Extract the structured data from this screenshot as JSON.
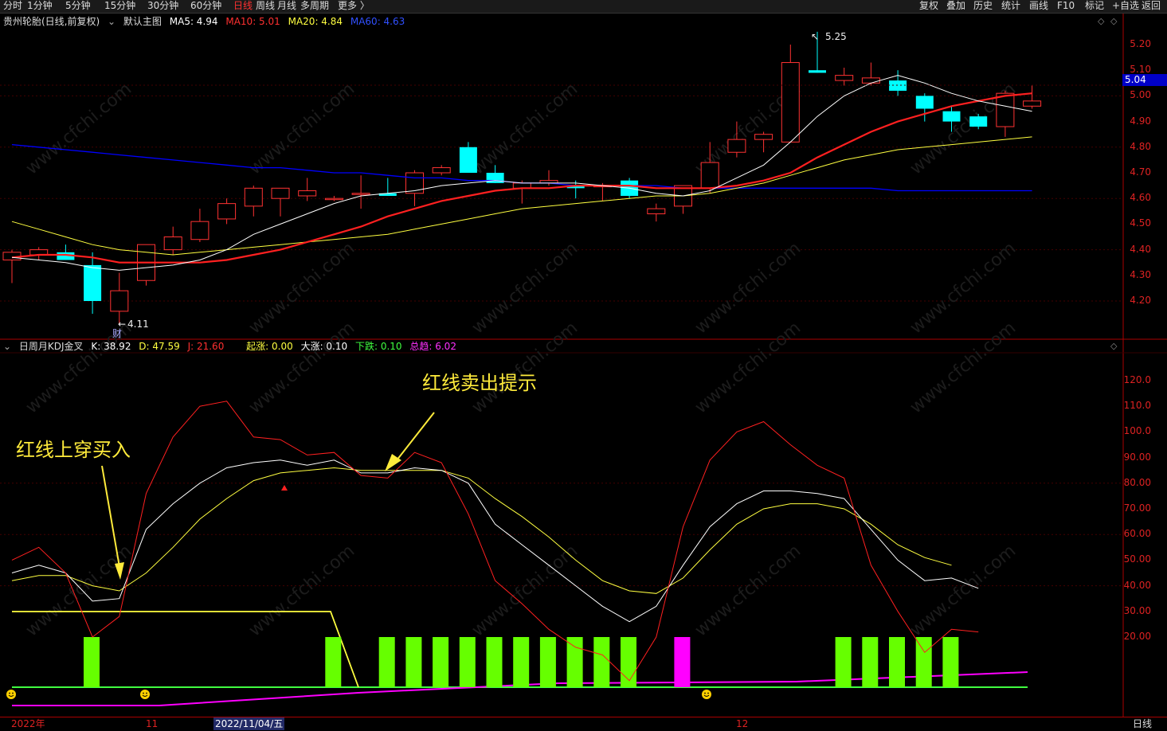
{
  "toolbar": {
    "items": [
      "分时",
      "1分钟",
      "5分钟",
      "15分钟",
      "30分钟",
      "60分钟",
      "日线",
      "周线",
      "月线",
      "多周期",
      "更多 〉"
    ],
    "active": "日线",
    "right_items": [
      "复权",
      "叠加",
      "历史",
      "统计",
      "画线",
      "F10",
      "标记",
      "+自选",
      "返回"
    ]
  },
  "main": {
    "stock": "贵州轮胎(日线,前复权)",
    "template": "默认主图",
    "ma5": "MA5: 4.94",
    "ma10": "MA10: 5.01",
    "ma20": "MA20: 4.84",
    "ma60": "MA60: 4.63",
    "high_label": "5.25",
    "low_label": "4.11",
    "finance_mark": "财",
    "current_price": "5.04",
    "price_ticks": [
      "5.20",
      "5.10",
      "5.00",
      "4.90",
      "4.80",
      "4.70",
      "4.60",
      "4.50",
      "4.40",
      "4.30",
      "4.20"
    ]
  },
  "kdj": {
    "name": "日周月KDJ金叉",
    "k": "K: 38.92",
    "d": "D: 47.59",
    "j": "J: 21.60",
    "qizhang": "起涨: 0.00",
    "dazhang": "大涨: 0.10",
    "xiadie": "下跌: 0.10",
    "zongqu": "总趋: 6.02",
    "ticks": [
      "120.0",
      "110.0",
      "100.0",
      "90.00",
      "80.00",
      "70.00",
      "60.00",
      "50.00",
      "40.00",
      "30.00",
      "20.00"
    ]
  },
  "annotations": {
    "buy": "红线上穿买入",
    "sell": "红线卖出提示"
  },
  "watermark": "www.cfchi.com",
  "bottom": {
    "labels": [
      "2022年",
      "11",
      "12"
    ],
    "selected_date": "2022/11/04/五",
    "period": "日线"
  },
  "colors": {
    "up": "#ff3232",
    "down": "#00ffff",
    "ma5": "#ffffff",
    "ma10": "#ff2020",
    "ma20": "#ffff40",
    "ma60": "#0000ff",
    "green_bar": "#66ff00",
    "magenta_bar": "#ff00ff"
  },
  "chart_data": {
    "type": "candlestick",
    "price_range": [
      4.11,
      5.25
    ],
    "candles": [
      {
        "o": 4.36,
        "h": 4.4,
        "l": 4.27,
        "c": 4.39
      },
      {
        "o": 4.38,
        "h": 4.41,
        "l": 4.36,
        "c": 4.4
      },
      {
        "o": 4.39,
        "h": 4.42,
        "l": 4.36,
        "c": 4.36
      },
      {
        "o": 4.34,
        "h": 4.39,
        "l": 4.15,
        "c": 4.2
      },
      {
        "o": 4.16,
        "h": 4.31,
        "l": 4.11,
        "c": 4.24
      },
      {
        "o": 4.28,
        "h": 4.42,
        "l": 4.26,
        "c": 4.42
      },
      {
        "o": 4.4,
        "h": 4.49,
        "l": 4.38,
        "c": 4.45
      },
      {
        "o": 4.44,
        "h": 4.56,
        "l": 4.43,
        "c": 4.51
      },
      {
        "o": 4.52,
        "h": 4.6,
        "l": 4.5,
        "c": 4.58
      },
      {
        "o": 4.57,
        "h": 4.65,
        "l": 4.53,
        "c": 4.64
      },
      {
        "o": 4.6,
        "h": 4.64,
        "l": 4.53,
        "c": 4.64
      },
      {
        "o": 4.61,
        "h": 4.68,
        "l": 4.59,
        "c": 4.63
      },
      {
        "o": 4.6,
        "h": 4.61,
        "l": 4.59,
        "c": 4.6
      },
      {
        "o": 4.62,
        "h": 4.69,
        "l": 4.56,
        "c": 4.62
      },
      {
        "o": 4.62,
        "h": 4.68,
        "l": 4.61,
        "c": 4.61
      },
      {
        "o": 4.62,
        "h": 4.71,
        "l": 4.57,
        "c": 4.7
      },
      {
        "o": 4.7,
        "h": 4.73,
        "l": 4.69,
        "c": 4.72
      },
      {
        "o": 4.8,
        "h": 4.82,
        "l": 4.7,
        "c": 4.7
      },
      {
        "o": 4.7,
        "h": 4.73,
        "l": 4.66,
        "c": 4.66
      },
      {
        "o": 4.64,
        "h": 4.67,
        "l": 4.58,
        "c": 4.66
      },
      {
        "o": 4.66,
        "h": 4.71,
        "l": 4.65,
        "c": 4.67
      },
      {
        "o": 4.65,
        "h": 4.67,
        "l": 4.6,
        "c": 4.64
      },
      {
        "o": 4.65,
        "h": 4.66,
        "l": 4.59,
        "c": 4.65
      },
      {
        "o": 4.67,
        "h": 4.68,
        "l": 4.6,
        "c": 4.61
      },
      {
        "o": 4.54,
        "h": 4.58,
        "l": 4.51,
        "c": 4.56
      },
      {
        "o": 4.57,
        "h": 4.64,
        "l": 4.54,
        "c": 4.65
      },
      {
        "o": 4.64,
        "h": 4.82,
        "l": 4.62,
        "c": 4.74
      },
      {
        "o": 4.78,
        "h": 4.9,
        "l": 4.76,
        "c": 4.83
      },
      {
        "o": 4.83,
        "h": 4.86,
        "l": 4.78,
        "c": 4.85
      },
      {
        "o": 4.82,
        "h": 5.2,
        "l": 4.82,
        "c": 5.13
      },
      {
        "o": 5.1,
        "h": 5.25,
        "l": 5.09,
        "c": 5.09
      },
      {
        "o": 5.06,
        "h": 5.11,
        "l": 5.04,
        "c": 5.08
      },
      {
        "o": 5.05,
        "h": 5.13,
        "l": 5.04,
        "c": 5.07
      },
      {
        "o": 5.06,
        "h": 5.1,
        "l": 5.0,
        "c": 5.02
      },
      {
        "o": 5.0,
        "h": 5.01,
        "l": 4.9,
        "c": 4.95
      },
      {
        "o": 4.94,
        "h": 4.96,
        "l": 4.86,
        "c": 4.9
      },
      {
        "o": 4.92,
        "h": 4.93,
        "l": 4.87,
        "c": 4.88
      },
      {
        "o": 4.88,
        "h": 5.02,
        "l": 4.84,
        "c": 5.01
      },
      {
        "o": 4.96,
        "h": 5.04,
        "l": 4.95,
        "c": 4.98
      }
    ],
    "ma5": [
      4.37,
      4.36,
      4.35,
      4.33,
      4.32,
      4.33,
      4.34,
      4.36,
      4.4,
      4.46,
      4.5,
      4.54,
      4.58,
      4.61,
      4.62,
      4.63,
      4.65,
      4.66,
      4.67,
      4.66,
      4.66,
      4.66,
      4.65,
      4.64,
      4.62,
      4.61,
      4.63,
      4.68,
      4.73,
      4.82,
      4.92,
      5.0,
      5.05,
      5.08,
      5.05,
      5.01,
      4.98,
      4.96,
      4.94
    ],
    "ma10": [
      4.37,
      4.38,
      4.38,
      4.37,
      4.35,
      4.35,
      4.35,
      4.35,
      4.36,
      4.38,
      4.4,
      4.43,
      4.46,
      4.49,
      4.53,
      4.56,
      4.59,
      4.61,
      4.63,
      4.64,
      4.64,
      4.65,
      4.65,
      4.65,
      4.64,
      4.64,
      4.64,
      4.65,
      4.67,
      4.7,
      4.76,
      4.81,
      4.86,
      4.9,
      4.93,
      4.96,
      4.98,
      5.0,
      5.01
    ],
    "ma20": [
      4.51,
      4.48,
      4.45,
      4.42,
      4.4,
      4.39,
      4.38,
      4.39,
      4.4,
      4.41,
      4.42,
      4.43,
      4.44,
      4.45,
      4.46,
      4.48,
      4.5,
      4.52,
      4.54,
      4.56,
      4.57,
      4.58,
      4.59,
      4.6,
      4.61,
      4.61,
      4.62,
      4.64,
      4.66,
      4.69,
      4.72,
      4.75,
      4.77,
      4.79,
      4.8,
      4.81,
      4.82,
      4.83,
      4.84
    ],
    "ma60": [
      4.81,
      4.8,
      4.79,
      4.78,
      4.77,
      4.76,
      4.75,
      4.74,
      4.73,
      4.72,
      4.72,
      4.71,
      4.7,
      4.7,
      4.69,
      4.68,
      4.68,
      4.67,
      4.67,
      4.66,
      4.66,
      4.65,
      4.65,
      4.65,
      4.65,
      4.64,
      4.64,
      4.64,
      4.64,
      4.64,
      4.64,
      4.64,
      4.64,
      4.63,
      4.63,
      4.63,
      4.63,
      4.63,
      4.63
    ],
    "kdj_range": [
      0,
      130
    ],
    "k": [
      45,
      48,
      45,
      34,
      35,
      62,
      72,
      80,
      86,
      88,
      89,
      87,
      89,
      84,
      84,
      86,
      85,
      80,
      64,
      56,
      48,
      40,
      32,
      26,
      32,
      48,
      63,
      72,
      77,
      77,
      76,
      74,
      62,
      50,
      42,
      43,
      39
    ],
    "d": [
      42,
      44,
      44,
      40,
      38,
      45,
      55,
      66,
      74,
      81,
      84,
      85,
      86,
      85,
      85,
      85,
      85,
      82,
      74,
      67,
      59,
      50,
      42,
      38,
      37,
      43,
      54,
      64,
      70,
      72,
      72,
      70,
      64,
      56,
      51,
      48
    ],
    "j": [
      50,
      55,
      45,
      20,
      28,
      76,
      98,
      110,
      112,
      98,
      97,
      91,
      92,
      83,
      82,
      92,
      88,
      68,
      42,
      33,
      23,
      16,
      13,
      3,
      20,
      63,
      89,
      100,
      104,
      95,
      87,
      82,
      48,
      30,
      14,
      23,
      22
    ],
    "j_x_offset": [
      0,
      1,
      2,
      3,
      4,
      5,
      6,
      7,
      8,
      9,
      10,
      11,
      12,
      13,
      14,
      15,
      16,
      17,
      18,
      19,
      20,
      21,
      22,
      23,
      24,
      25,
      26,
      27,
      28,
      29,
      30,
      31,
      32,
      33,
      34,
      35,
      36
    ],
    "green_bars": [
      3,
      12,
      14,
      15,
      16,
      17,
      18,
      19,
      20,
      21,
      22,
      23,
      31,
      32,
      33,
      34,
      35
    ],
    "magenta_bars": [
      25
    ]
  }
}
